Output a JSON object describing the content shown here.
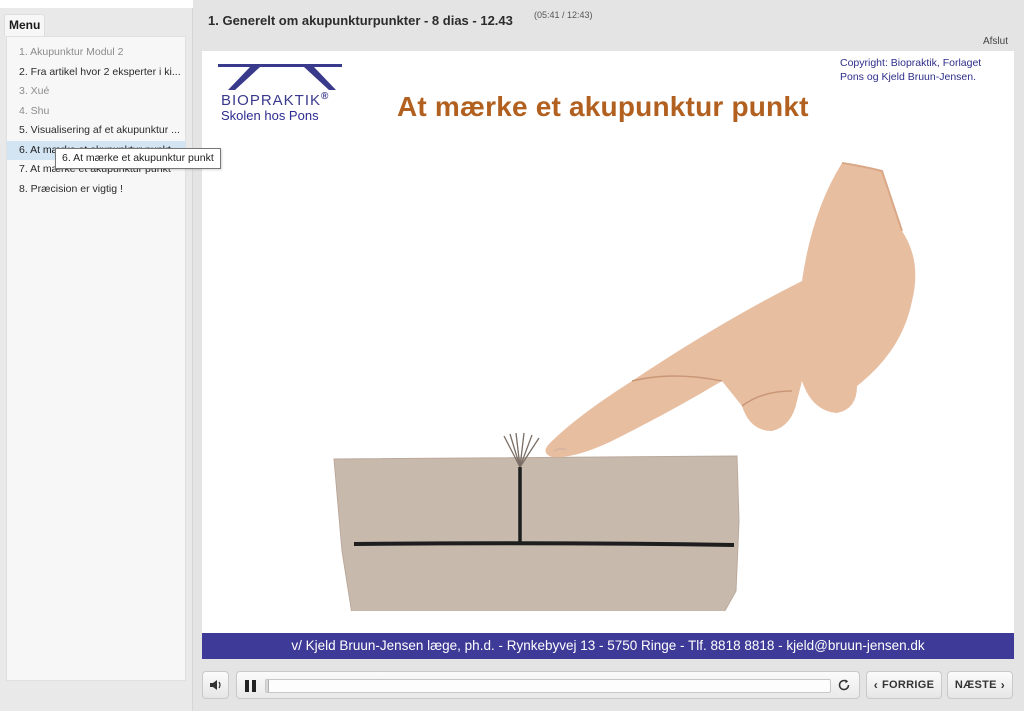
{
  "sidebar": {
    "menu_tab": "Menu",
    "items": [
      {
        "label": "1. Akupunktur Modul 2",
        "state": "visited"
      },
      {
        "label": "2. Fra artikel hvor 2 eksperter i ki...",
        "state": "normal"
      },
      {
        "label": "3. Xué",
        "state": "visited"
      },
      {
        "label": "4. Shu",
        "state": "visited"
      },
      {
        "label": "5. Visualisering af et akupunktur ...",
        "state": "normal"
      },
      {
        "label": "6. At mærke et akupunktur punkt",
        "state": "active"
      },
      {
        "label": "7. At mærke et akupunktur punkt",
        "state": "normal"
      },
      {
        "label": "8. Præcision er vigtig !",
        "state": "normal"
      }
    ],
    "tooltip": "6. At mærke et akupunktur punkt"
  },
  "header": {
    "title": "1. Generelt om akupunkturpunkter - 8 dias - 12.43",
    "time": "(05:41 / 12:43)",
    "exit": "Afslut"
  },
  "slide": {
    "logo_line1": "BIOPRAKTIK",
    "logo_registered": "®",
    "logo_line2": "Skolen hos Pons",
    "copyright": "Copyright: Biopraktik, Forlaget Pons og Kjeld Bruun-Jensen.",
    "heading": "At mærke et akupunktur punkt",
    "footer": "v/ Kjeld Bruun-Jensen læge, ph.d.  -  Rynkebyvej 13  -  5750 Ringe  -  Tlf. 8818 8818  -  kjeld@bruun-jensen.dk"
  },
  "player": {
    "progress_fraction": 0.005,
    "prev_label": "FORRIGE",
    "next_label": "NÆSTE"
  },
  "colors": {
    "heading": "#b2601f",
    "footer_bar": "#3e3a97",
    "logo": "#3a3a8c",
    "active_item": "#d3e4f2"
  }
}
